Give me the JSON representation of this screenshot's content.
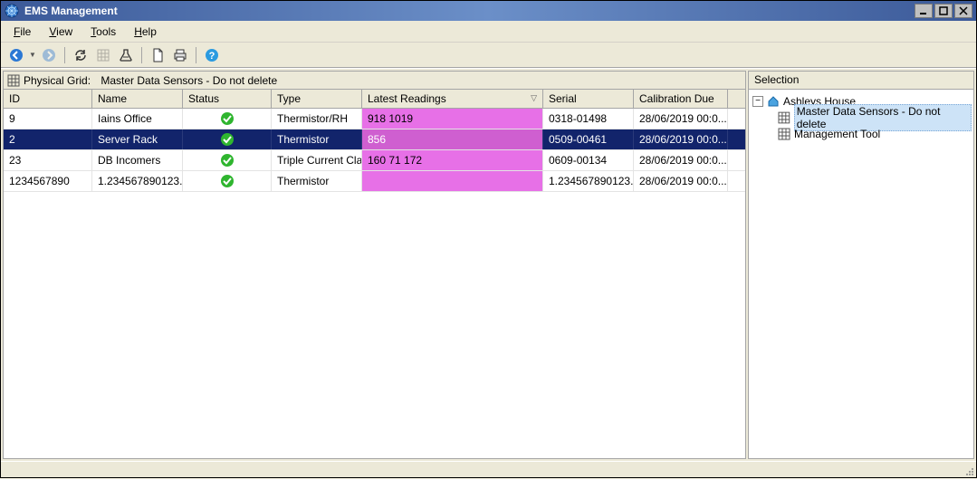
{
  "window": {
    "title": "EMS Management"
  },
  "menu": {
    "file": "File",
    "view": "View",
    "tools": "Tools",
    "help": "Help"
  },
  "panel": {
    "caption_prefix": "Physical Grid:",
    "caption_name": "Master Data Sensors - Do not delete"
  },
  "grid": {
    "headers": {
      "id": "ID",
      "name": "Name",
      "status": "Status",
      "type": "Type",
      "readings": "Latest Readings",
      "serial": "Serial",
      "calibration": "Calibration Due"
    },
    "sort_column": "readings",
    "rows": [
      {
        "id": "9",
        "name": "Iains Office",
        "status": "ok",
        "type": "Thermistor/RH",
        "readings": "918  1019",
        "serial": "0318-01498",
        "calibration": "28/06/2019 00:0...",
        "selected": false
      },
      {
        "id": "2",
        "name": "Server Rack",
        "status": "ok",
        "type": "Thermistor",
        "readings": "856",
        "serial": "0509-00461",
        "calibration": "28/06/2019 00:0...",
        "selected": true
      },
      {
        "id": "23",
        "name": "DB Incomers",
        "status": "ok",
        "type": "Triple Current Cla...",
        "readings": "160  71  172",
        "serial": "0609-00134",
        "calibration": "28/06/2019 00:0...",
        "selected": false
      },
      {
        "id": "1234567890",
        "name": "1.234567890123...",
        "status": "ok",
        "type": "Thermistor",
        "readings": "",
        "serial": "1.234567890123...",
        "calibration": "28/06/2019 00:0...",
        "selected": false
      }
    ]
  },
  "selection_panel": {
    "title": "Selection",
    "root": "Ashleys House",
    "children": [
      {
        "label": "Master Data Sensors - Do not delete",
        "selected": true
      },
      {
        "label": "Management Tool",
        "selected": false
      }
    ]
  }
}
